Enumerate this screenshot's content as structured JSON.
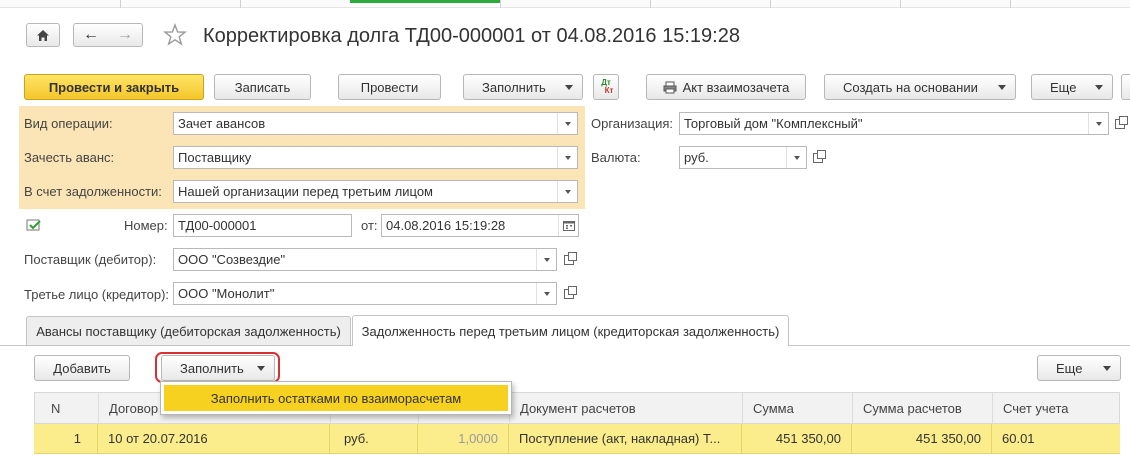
{
  "window": {
    "title": "Корректировка долга ТД00-000001 от 04.08.2016 15:19:28"
  },
  "toolbar": {
    "post_close": "Провести и закрыть",
    "save": "Записать",
    "post": "Провести",
    "fill": "Заполнить",
    "act": "Акт взаимозачета",
    "create_based": "Создать на основании",
    "more": "Еще"
  },
  "icons": {
    "dt_kt_top": "Дт",
    "dt_kt_bottom": "Кт"
  },
  "form": {
    "operation_type_label": "Вид операции:",
    "operation_type_value": "Зачет авансов",
    "offset_advance_label": "Зачесть аванс:",
    "offset_advance_value": "Поставщику",
    "debt_account_label": "В счет задолженности:",
    "debt_account_value": "Нашей организации перед третьим лицом",
    "number_label": "Номер:",
    "number_value": "ТД00-000001",
    "date_label": "от:",
    "date_value": "04.08.2016 15:19:28",
    "supplier_label": "Поставщик (дебитор):",
    "supplier_value": "ООО \"Созвездие\"",
    "third_party_label": "Третье лицо (кредитор):",
    "third_party_value": "ООО \"Монолит\"",
    "organization_label": "Организация:",
    "organization_value": "Торговый дом \"Комплексный\"",
    "currency_label": "Валюта:",
    "currency_value": "руб."
  },
  "tabs": [
    {
      "label": "Авансы поставщику (дебиторская задолженность)"
    },
    {
      "label": "Задолженность перед третьим лицом (кредиторская задолженность)"
    }
  ],
  "table_toolbar": {
    "add": "Добавить",
    "fill": "Заполнить",
    "more": "Еще"
  },
  "popup": {
    "item": "Заполнить остатками по взаиморасчетам"
  },
  "table": {
    "columns": [
      "N",
      "Договор",
      "",
      "",
      "Документ расчетов",
      "Сумма",
      "Сумма расчетов",
      "Счет учета"
    ],
    "rows": [
      {
        "n": "1",
        "contract": "10 от 20.07.2016",
        "currency": "руб.",
        "rate": "1,0000",
        "document": "Поступление (акт, накладная) Т...",
        "amount": "451 350,00",
        "settlement_amount": "451 350,00",
        "account": "60.01"
      }
    ]
  }
}
